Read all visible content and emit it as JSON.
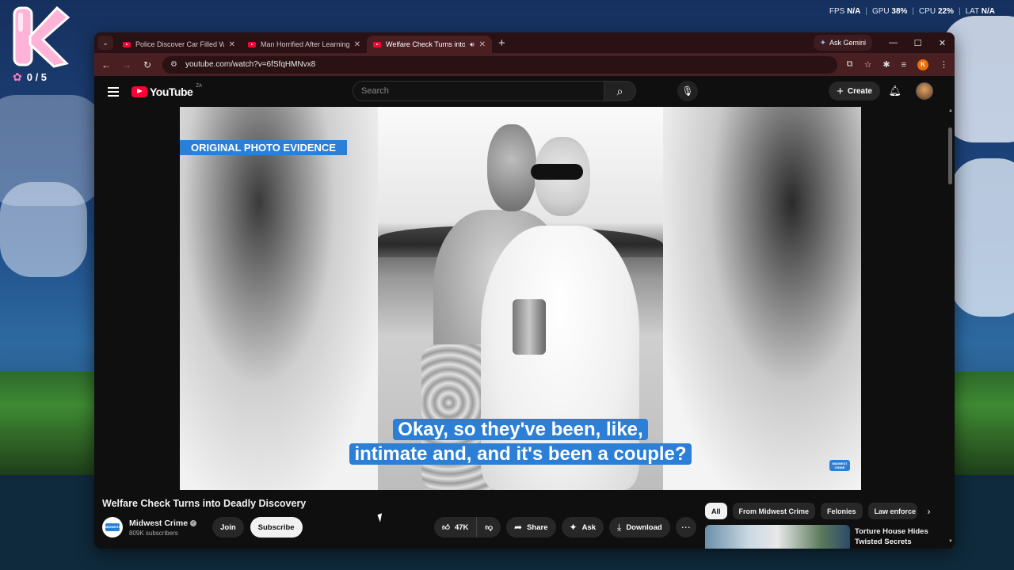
{
  "desktop": {
    "widget_letter": "K",
    "score": "0 / 5",
    "hud": [
      {
        "label": "FPS",
        "value": "N/A"
      },
      {
        "label": "GPU",
        "value": "38%"
      },
      {
        "label": "CPU",
        "value": "22%"
      },
      {
        "label": "LAT",
        "value": "N/A"
      }
    ]
  },
  "browser": {
    "tabs": [
      {
        "title": "Police Discover Car Filled With",
        "active": false
      },
      {
        "title": "Man Horrified After Learning G",
        "active": false
      },
      {
        "title": "Welfare Check Turns into D",
        "active": true
      }
    ],
    "gemini_label": "Ask Gemini",
    "url": "youtube.com/watch?v=6fSfqHMNvx8",
    "profile_letter": "K"
  },
  "youtube": {
    "logo_text": "YouTube",
    "country": "ZA",
    "search_placeholder": "Search",
    "create_label": "Create",
    "video": {
      "overlay_label": "ORIGINAL PHOTO EVIDENCE",
      "caption_lines": [
        "Okay, so they've been, like,",
        "intimate and, and it's been a couple?"
      ],
      "watermark": "MIDWEST CRIME"
    },
    "title": "Welfare Check Turns into Deadly Discovery",
    "channel": {
      "name": "Midwest Crime",
      "subscribers": "809K subscribers",
      "avatar_text": "MIDWEST CRIME"
    },
    "join_label": "Join",
    "subscribe_label": "Subscribe",
    "likes": "47K",
    "share_label": "Share",
    "ask_label": "Ask",
    "download_label": "Download",
    "chips": [
      "All",
      "From Midwest Crime",
      "Felonies",
      "Law enforce"
    ],
    "recommended": [
      {
        "title": "Torture House Hides Twisted Secrets"
      }
    ]
  }
}
